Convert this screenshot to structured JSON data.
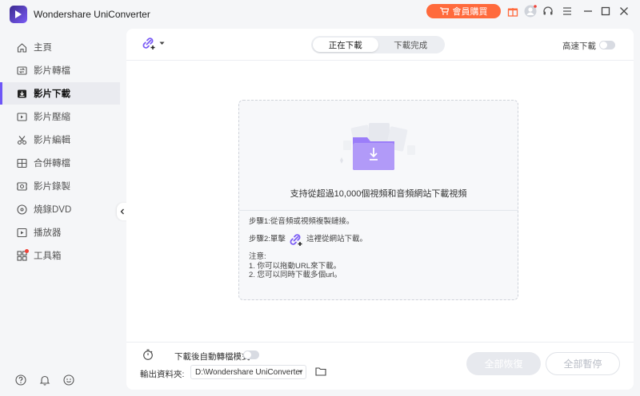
{
  "app": {
    "title": "Wondershare UniConverter",
    "buy_label": "會員購買"
  },
  "colors": {
    "accent": "#6e56f7",
    "buy": "#ff6a3c"
  },
  "sidebar": {
    "items": [
      {
        "label": "主頁",
        "icon": "home-icon"
      },
      {
        "label": "影片轉檔",
        "icon": "convert-icon"
      },
      {
        "label": "影片下載",
        "icon": "download-icon",
        "active": true
      },
      {
        "label": "影片壓縮",
        "icon": "compress-icon"
      },
      {
        "label": "影片編輯",
        "icon": "scissors-icon"
      },
      {
        "label": "合併轉檔",
        "icon": "merge-icon"
      },
      {
        "label": "影片錄製",
        "icon": "record-icon"
      },
      {
        "label": "燒錄DVD",
        "icon": "dvd-icon"
      },
      {
        "label": "播放器",
        "icon": "player-icon"
      },
      {
        "label": "工具箱",
        "icon": "toolbox-icon"
      }
    ]
  },
  "topbar": {
    "tabs": [
      {
        "label": "正在下載",
        "active": true
      },
      {
        "label": "下載完成",
        "active": false
      }
    ],
    "high_speed_label": "高速下載"
  },
  "dropzone": {
    "support_text": "支持從超過10,000個視頻和音頻網站下載視頻",
    "step1": "步驟1:從音頻或視頻複製鏈接。",
    "step2_prefix": "步驟2:單擊",
    "step2_suffix": "這裡從網站下載。",
    "note_title": "注意:",
    "note1": "1. 你可以拖動URL來下載。",
    "note2": "2. 您可以同時下載多個url。"
  },
  "footer": {
    "auto_convert_label": "下載後自動轉檔模式",
    "output_label": "輸出資料夾:",
    "output_path": "D:\\Wondershare UniConverter",
    "resume_all": "全部恢復",
    "pause_all": "全部暫停"
  }
}
